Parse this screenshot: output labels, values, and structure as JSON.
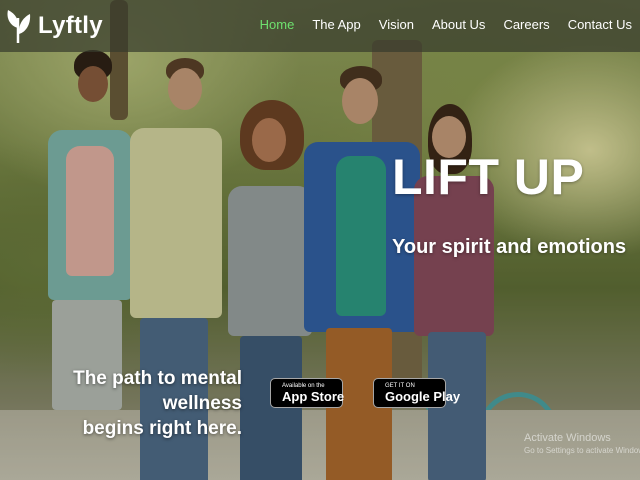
{
  "brand": {
    "name": "Lyftly",
    "logo_icon": "leaf-icon"
  },
  "nav": {
    "items": [
      {
        "label": "Home",
        "active": true
      },
      {
        "label": "The App",
        "active": false
      },
      {
        "label": "Vision",
        "active": false
      },
      {
        "label": "About Us",
        "active": false
      },
      {
        "label": "Careers",
        "active": false
      },
      {
        "label": "Contact Us",
        "active": false
      }
    ],
    "active_color": "#6ee06e"
  },
  "hero": {
    "title": "LIFT UP",
    "subtitle": "Your spirit and emotions",
    "tagline_line1": "The path to mental wellness",
    "tagline_line2": "begins right here."
  },
  "badges": {
    "app_store": {
      "small": "Available on the",
      "big": "App Store",
      "icon": "apple-icon"
    },
    "google_play": {
      "small": "GET IT ON",
      "big": "Google Play",
      "icon": "play-icon"
    }
  },
  "watermark": {
    "line1": "Activate Windows",
    "line2": "Go to Settings to activate Windows."
  }
}
